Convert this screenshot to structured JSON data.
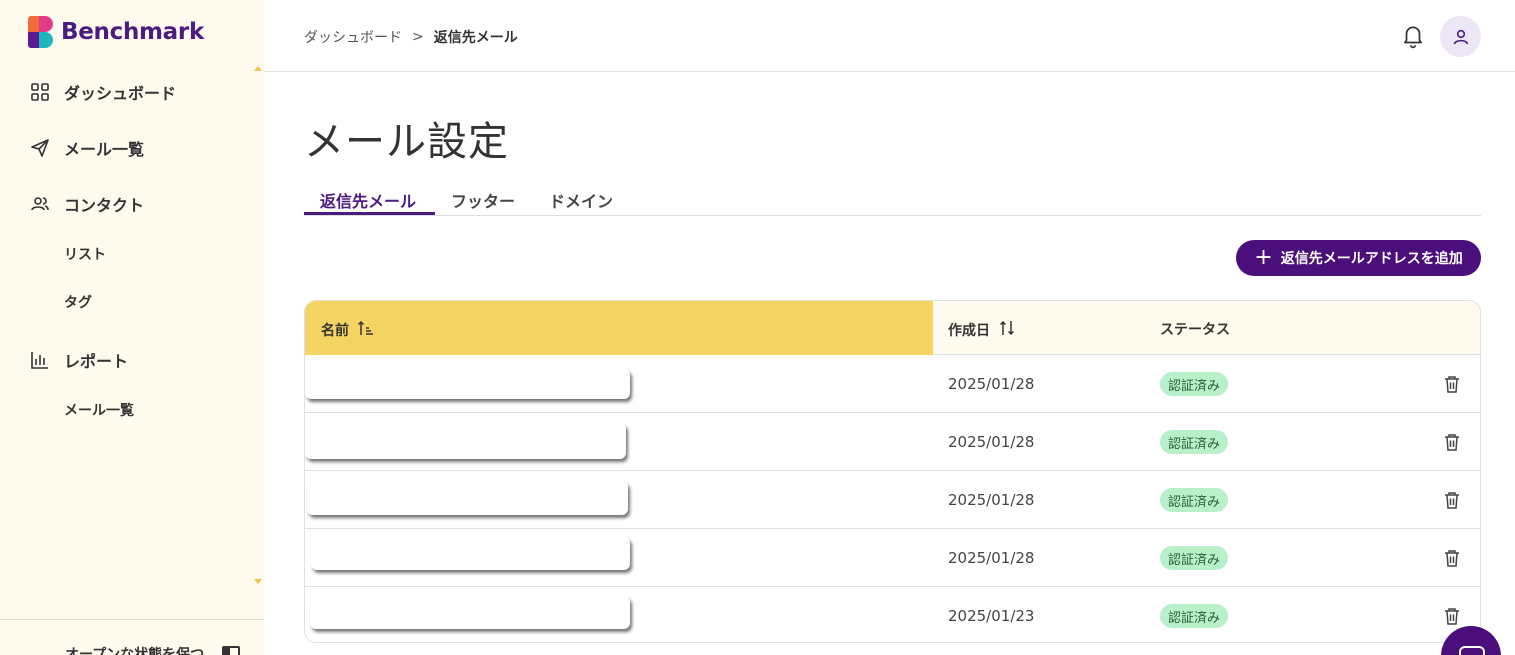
{
  "brand": {
    "name": "Benchmark"
  },
  "sidebar": {
    "items": [
      {
        "label": "ダッシュボード",
        "icon": "grid-icon"
      },
      {
        "label": "メール一覧",
        "icon": "send-icon"
      },
      {
        "label": "コンタクト",
        "icon": "users-icon"
      },
      {
        "label": "リスト"
      },
      {
        "label": "タグ"
      },
      {
        "label": "レポート",
        "icon": "chart-icon"
      },
      {
        "label": "メール一覧"
      }
    ],
    "footer_label": "オープンな状態を保つ"
  },
  "header": {
    "breadcrumb": [
      "ダッシュボード",
      "返信先メール"
    ],
    "breadcrumb_separator": ">"
  },
  "page": {
    "title": "メール設定",
    "tabs": [
      "返信先メール",
      "フッター",
      "ドメイン"
    ],
    "active_tab": 0,
    "add_button_label": "返信先メールアドレスを追加"
  },
  "table": {
    "columns": [
      "名前",
      "作成日",
      "ステータス"
    ],
    "rows": [
      {
        "name": "",
        "date": "2025/01/28",
        "status": "認証済み"
      },
      {
        "name": "",
        "date": "2025/01/28",
        "status": "認証済み"
      },
      {
        "name": "",
        "date": "2025/01/28",
        "status": "認証済み"
      },
      {
        "name": "",
        "date": "2025/01/28",
        "status": "認証済み"
      },
      {
        "name": "",
        "date": "2025/01/23",
        "status": "認証済み"
      }
    ]
  },
  "colors": {
    "brand_purple": "#4a0f7a",
    "sidebar_bg": "#fefaee",
    "sort_header_bg": "#f4d463",
    "status_badge_bg": "#b8f0c9"
  }
}
